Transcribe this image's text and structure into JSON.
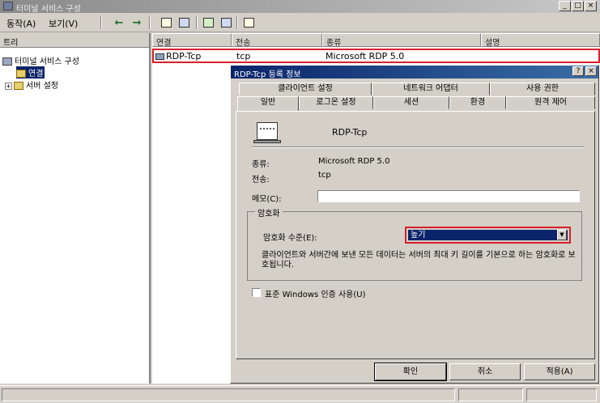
{
  "window": {
    "title": "터미널 서비스 구성",
    "minimize": "_",
    "maximize": "□",
    "close": "×"
  },
  "menu": {
    "items": [
      "동작(A)",
      "보기(V)"
    ]
  },
  "toolbar": {
    "back": "←",
    "forward": "→"
  },
  "tree": {
    "header": "트리",
    "root": "터미널 서비스 구성",
    "children": [
      "연결",
      "서버 설정"
    ]
  },
  "list": {
    "columns": [
      "연결",
      "전송",
      "종류",
      "설명"
    ],
    "rows": [
      {
        "name": "RDP-Tcp",
        "transport": "tcp",
        "type": "Microsoft RDP 5.0",
        "desc": ""
      }
    ]
  },
  "dialog": {
    "title": "RDP-Tcp 등록 정보",
    "help_btn": "?",
    "close_btn": "×",
    "tabs_row1": [
      "클라이언트 설정",
      "네트워크 어댑터",
      "사용 권한"
    ],
    "tabs_row2": [
      "일반",
      "로그온 설정",
      "세션",
      "환경",
      "원격 제어"
    ],
    "connection_name": "RDP-Tcp",
    "type_label": "종류:",
    "type_value": "Microsoft RDP 5.0",
    "transport_label": "전송:",
    "transport_value": "tcp",
    "comment_label": "메모(C):",
    "comment_value": "",
    "encryption_group": "암호화",
    "encryption_level_label": "암호화 수준(E):",
    "encryption_level_value": "높기",
    "encryption_desc": "클라이언트와 서버간에 보낸 모든 데이터는 서버의 최대 키 길이를 기본으로 하는 암호화로 보호됩니다.",
    "windows_auth_label": "표준 Windows 인증 사용(U)",
    "windows_auth_checked": false,
    "buttons": {
      "ok": "확인",
      "cancel": "취소",
      "apply": "적용(A)"
    }
  }
}
